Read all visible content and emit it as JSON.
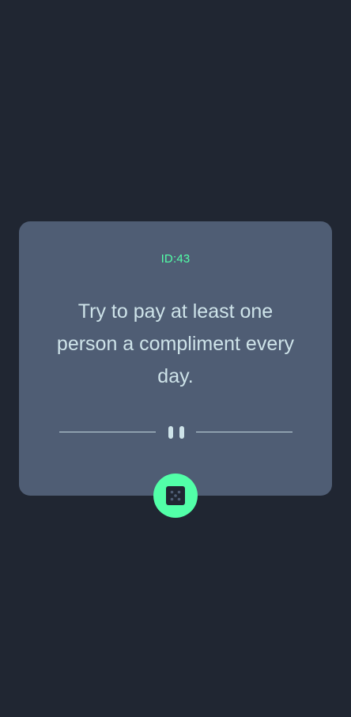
{
  "advice": {
    "id_label": "ID:43",
    "text": "Try to pay at least one person a compliment every day."
  },
  "divider": {
    "icon": "pause-icon"
  },
  "dice_button": {
    "icon": "dice-icon"
  },
  "colors": {
    "background": "#202632",
    "card": "#4f5d74",
    "accent": "#52ffa8",
    "text": "#cee3e9"
  }
}
